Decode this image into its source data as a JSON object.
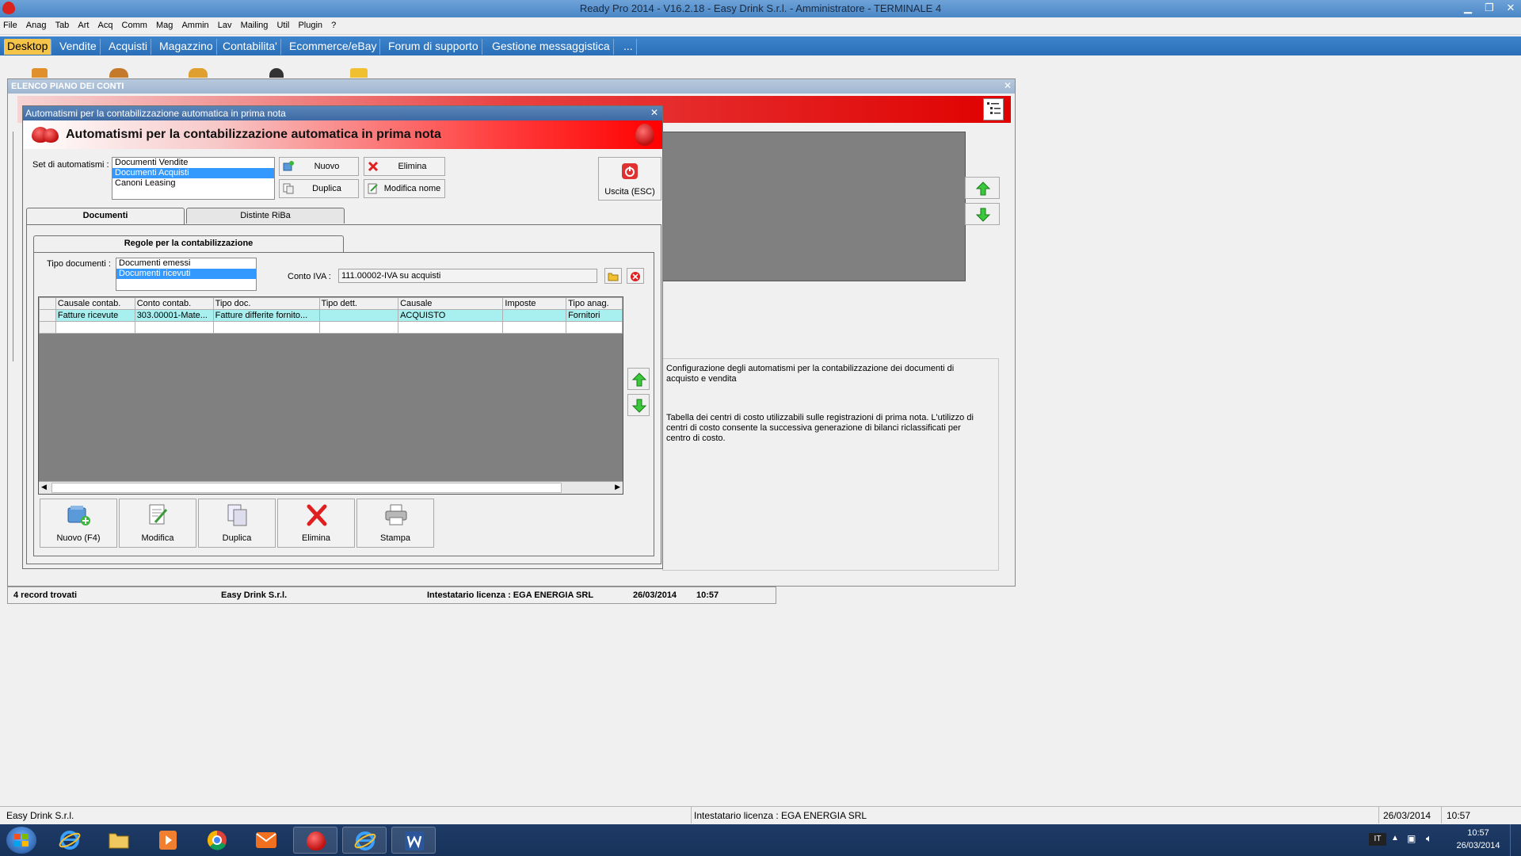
{
  "window": {
    "title": "Ready Pro 2014 - V16.2.18 - Easy Drink S.r.l. - Amministratore - TERMINALE 4",
    "controls": [
      "▁",
      "❐",
      "✕"
    ]
  },
  "menu": [
    "File",
    "Anag",
    "Tab",
    "Art",
    "Acq",
    "Comm",
    "Mag",
    "Ammin",
    "Lav",
    "Mailing",
    "Util",
    "Plugin",
    "?"
  ],
  "topnav": [
    "Desktop",
    "Vendite",
    "Acquisti",
    "Magazzino",
    "Contabilita'",
    "Ecommerce/eBay",
    "Forum di supporto",
    "Gestione messaggistica",
    "..."
  ],
  "bg_window": {
    "title": "ELENCO PIANO DEI CONTI",
    "close": "✕",
    "description_1": "Configurazione degli automatismi per la contabilizzazione dei documenti di acquisto e vendita",
    "description_2": "Tabella dei centri di costo utilizzabili sulle registrazioni di prima nota. L'utilizzo di centri di costo consente la successiva generazione di bilanci riclassificati per centro di costo.",
    "status": {
      "records": "4 record trovati",
      "company": "Easy Drink S.r.l.",
      "license": "Intestatario licenza : EGA ENERGIA SRL",
      "date": "26/03/2014",
      "time": "10:57"
    }
  },
  "dialog": {
    "caption": "Automatismi per la contabilizzazione automatica in prima nota",
    "close": "✕",
    "header_title": "Automatismi per la contabilizzazione automatica in prima nota",
    "set_label": "Set di automatismi :",
    "sets": [
      "Documenti Vendite",
      "Documenti Acquisti",
      "Canoni Leasing"
    ],
    "buttons": {
      "nuovo": "Nuovo",
      "elimina": "Elimina",
      "duplica": "Duplica",
      "modifica_nome": "Modifica nome",
      "uscita": "Uscita (ESC)"
    },
    "tabs": [
      "Documenti",
      "Distinte RiBa"
    ],
    "inner_tab": "Regole per la contabilizzazione",
    "tipo_documenti_label": "Tipo documenti :",
    "tipo_documenti": [
      "Documenti emessi",
      "Documenti ricevuti"
    ],
    "conto_iva_label": "Conto IVA :",
    "conto_iva_value": "111.00002-IVA su acquisti",
    "grid": {
      "columns": [
        "Causale contab.",
        "Conto contab.",
        "Tipo doc.",
        "Tipo dett.",
        "Causale",
        "Imposte",
        "Tipo anag."
      ],
      "rows": [
        [
          "Fatture ricevute",
          "303.00001-Mate...",
          "Fatture differite fornito...",
          "",
          "ACQUISTO",
          "",
          "Fornitori"
        ]
      ]
    },
    "actions": [
      "Nuovo (F4)",
      "Modifica",
      "Duplica",
      "Elimina",
      "Stampa"
    ]
  },
  "statusbar": {
    "company": "Easy Drink S.r.l.",
    "license": "Intestatario licenza : EGA ENERGIA SRL",
    "date": "26/03/2014",
    "time": "10:57"
  },
  "taskbar": {
    "lang": "IT",
    "time": "10:57",
    "date": "26/03/2014"
  }
}
